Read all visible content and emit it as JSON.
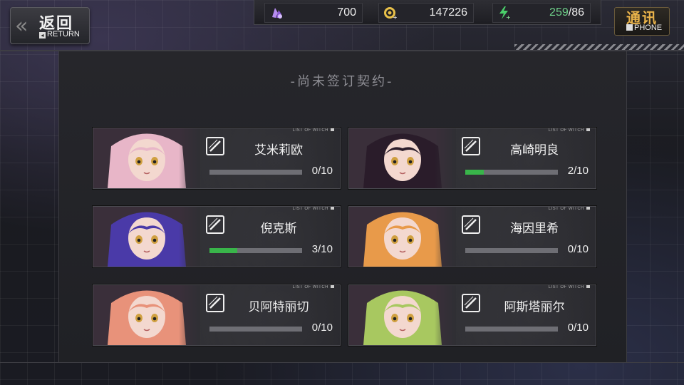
{
  "header": {
    "return_cn": "返回",
    "return_en": "RETURN",
    "phone_cn": "通讯",
    "phone_en": "PHONE"
  },
  "resources": [
    {
      "name": "crystal",
      "icon": "crystal-icon",
      "value": "700"
    },
    {
      "name": "gold",
      "icon": "coin-icon",
      "value": "147226"
    },
    {
      "name": "stamina",
      "icon": "energy-icon",
      "current": "259",
      "max": "/86"
    }
  ],
  "panel": {
    "title": "-尚未签订契约-"
  },
  "card_tag": "LIST OF WITCH",
  "witches": [
    {
      "name": "艾米莉欧",
      "progress_text": "0/10",
      "progress": 0,
      "hair": "#e8b6c8"
    },
    {
      "name": "高崎明良",
      "progress_text": "2/10",
      "progress": 0.2,
      "hair": "#2a1c2a"
    },
    {
      "name": "倪克斯",
      "progress_text": "3/10",
      "progress": 0.3,
      "hair": "#4a3aa8"
    },
    {
      "name": "海因里希",
      "progress_text": "0/10",
      "progress": 0,
      "hair": "#e89a4a"
    },
    {
      "name": "贝阿特丽切",
      "progress_text": "0/10",
      "progress": 0,
      "hair": "#e8927a"
    },
    {
      "name": "阿斯塔丽尔",
      "progress_text": "0/10",
      "progress": 0,
      "hair": "#a8c860"
    }
  ],
  "colors": {
    "accent_green": "#39b54a",
    "phone_gold": "#e8b24a",
    "stamina_green": "#6fd08a"
  }
}
